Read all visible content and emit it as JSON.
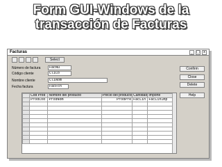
{
  "slide": {
    "title_line1": "Form GUI-Windows de la",
    "title_line2": "transacción de Facturas"
  },
  "window": {
    "title": "Facturas",
    "controls": [
      "_",
      "□",
      "x"
    ]
  },
  "toolbar": {
    "select_label": "Select"
  },
  "form": {
    "numero_label": "Número de factura",
    "numero_value": "FacNu",
    "codigo_label": "Código cliente",
    "codigo_value": "CliCo",
    "nombre_label": "Nombre cliente",
    "nombre_value": "CliNom",
    "fecha_label": "Fecha factura",
    "fecha_value": "FacFch"
  },
  "side_buttons": {
    "confirm": "Confirm",
    "close": "Close",
    "delete": "Delete",
    "help": "Help"
  },
  "grid": {
    "columns": [
      "Cod Prod",
      "Nombre del producto",
      "Precio del producto",
      "Cantidad",
      "Importe"
    ],
    "first_row": [
      "ProdCod",
      "ProdNom",
      "ProdPre",
      "FacLin",
      "FacLinImp"
    ]
  }
}
